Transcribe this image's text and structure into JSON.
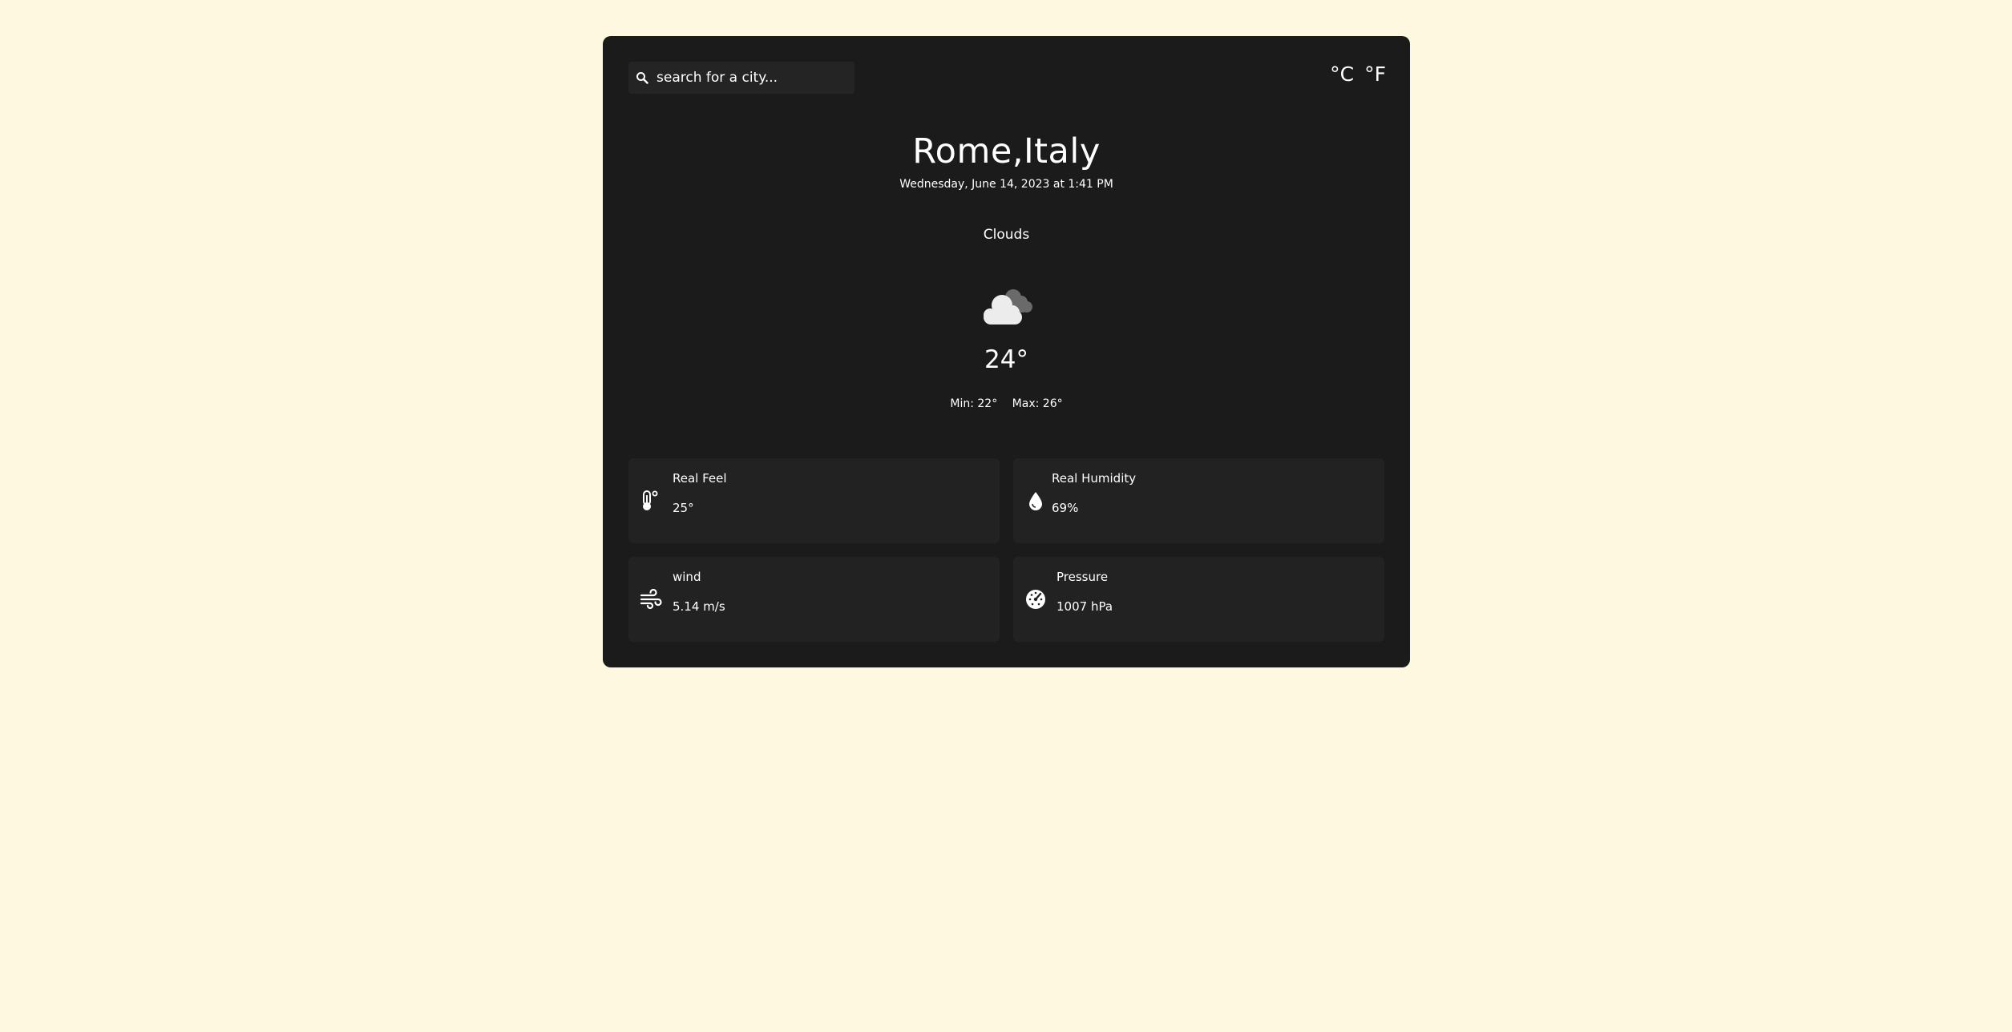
{
  "search": {
    "placeholder": "search for a city..."
  },
  "units": {
    "celsius": "°C",
    "fahrenheit": "°F"
  },
  "location": {
    "city": "Rome,Italy",
    "datetime": "Wednesday, June 14, 2023 at 1:41 PM"
  },
  "weather": {
    "condition": "Clouds",
    "icon": "clouds-icon",
    "temperature": "24°",
    "min": "Min: 22°",
    "max": "Max: 26°"
  },
  "details": {
    "real_feel": {
      "label": "Real Feel",
      "value": "25°",
      "icon": "thermometer-icon"
    },
    "humidity": {
      "label": "Real Humidity",
      "value": "69%",
      "icon": "water-drop-icon"
    },
    "wind": {
      "label": "wind",
      "value": "5.14 m/s",
      "icon": "wind-icon"
    },
    "pressure": {
      "label": "Pressure",
      "value": "1007 hPa",
      "icon": "gauge-icon"
    }
  },
  "colors": {
    "page_background": "#fff8e1",
    "card_background": "#1b1b1b",
    "tile_background": "#222222",
    "text": "#ffffff"
  }
}
